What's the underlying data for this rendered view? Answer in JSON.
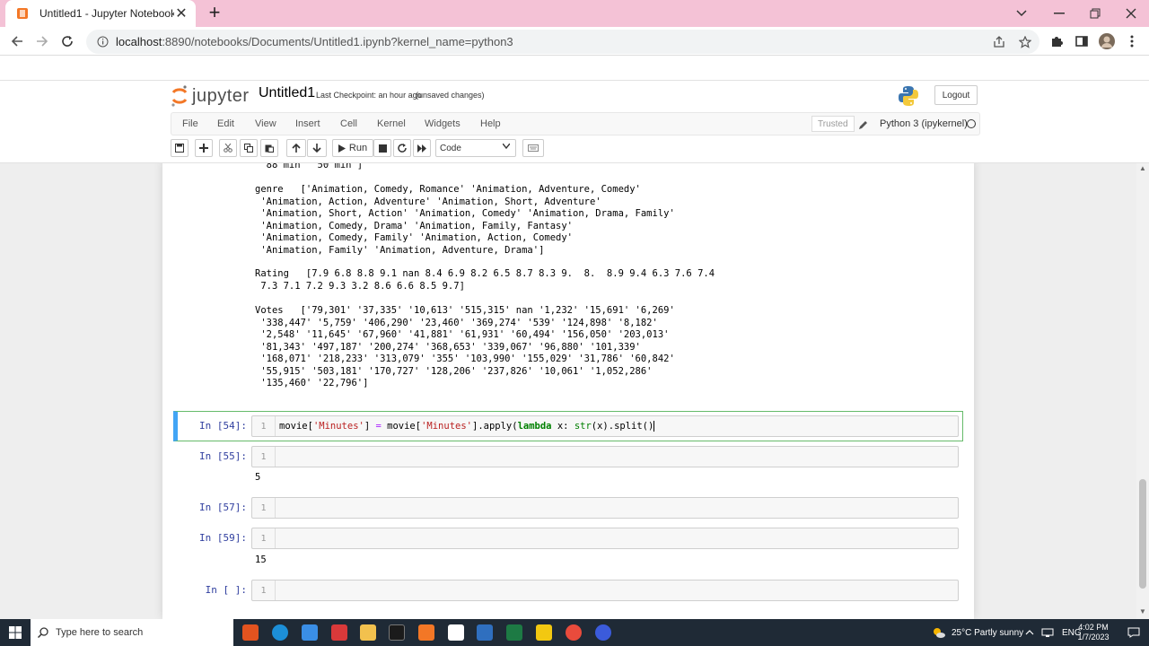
{
  "browser": {
    "tab_title": "Untitled1 - Jupyter Notebook",
    "tab_close": "✕",
    "new_tab": "+",
    "url_host": "localhost",
    "url_rest": ":8890/notebooks/Documents/Untitled1.ipynb?kernel_name=python3"
  },
  "jupyter": {
    "logo_word": "jupyter",
    "notebook_name": "Untitled1",
    "checkpoint": "Last Checkpoint: an hour ago",
    "unsaved": "(unsaved changes)",
    "logout": "Logout",
    "menu": [
      "File",
      "Edit",
      "View",
      "Insert",
      "Cell",
      "Kernel",
      "Widgets",
      "Help"
    ],
    "trusted": "Trusted",
    "kernel": "Python 3 (ipykernel)",
    "run_label": "Run",
    "cell_type": "Code"
  },
  "output": {
    "runtime_tail": " '88 min' '50 min']",
    "genre": "genre   ['Animation, Comedy, Romance' 'Animation, Adventure, Comedy'\n 'Animation, Action, Adventure' 'Animation, Short, Adventure'\n 'Animation, Short, Action' 'Animation, Comedy' 'Animation, Drama, Family'\n 'Animation, Comedy, Drama' 'Animation, Family, Fantasy'\n 'Animation, Comedy, Family' 'Animation, Action, Comedy'\n 'Animation, Family' 'Animation, Adventure, Drama']",
    "rating": "Rating   [7.9 6.8 8.8 9.1 nan 8.4 6.9 8.2 6.5 8.7 8.3 9.  8.  8.9 9.4 6.3 7.6 7.4\n 7.3 7.1 7.2 9.3 3.2 8.6 6.6 8.5 9.7]",
    "votes": "Votes   ['79,301' '37,335' '10,613' '515,315' nan '1,232' '15,691' '6,269'\n '338,447' '5,759' '406,290' '23,460' '369,274' '539' '124,898' '8,182'\n '2,548' '11,645' '67,960' '41,881' '61,931' '60,494' '156,050' '203,013'\n '81,343' '497,187' '200,274' '368,653' '339,067' '96,880' '101,339'\n '168,071' '218,233' '313,079' '355' '103,990' '155,029' '31,786' '60,842'\n '55,915' '503,181' '170,727' '128,206' '237,826' '10,061' '1,052,286'\n '135,460' '22,796']"
  },
  "cells": [
    {
      "prompt": "In [54]:",
      "line": "1",
      "code": {
        "a": "movie[",
        "b": "'Minutes'",
        "c": "] ",
        "d": "=",
        "e": " movie[",
        "f": "'Minutes'",
        "g": "].apply(",
        "h": "lambda",
        "i": " x: ",
        "j": "str",
        "k": "(x).split()"
      }
    },
    {
      "prompt": "In [55]:",
      "line": "1",
      "output": "5"
    },
    {
      "prompt": "In [57]:",
      "line": "1"
    },
    {
      "prompt": "In [59]:",
      "line": "1",
      "output": "15"
    },
    {
      "prompt": "In [ ]:",
      "line": "1"
    }
  ],
  "taskbar": {
    "search_placeholder": "Type here to search",
    "weather": "25°C  Partly sunny",
    "lang": "ENG",
    "time": "4:02 PM",
    "date": "1/7/2023"
  },
  "colors": {
    "tabbar": "#f4c2d6",
    "selected_cell_border": "#66bb6a",
    "selected_cell_left": "#42a5f5",
    "prompt": "#303f9f",
    "taskbar": "#1f2a36"
  }
}
